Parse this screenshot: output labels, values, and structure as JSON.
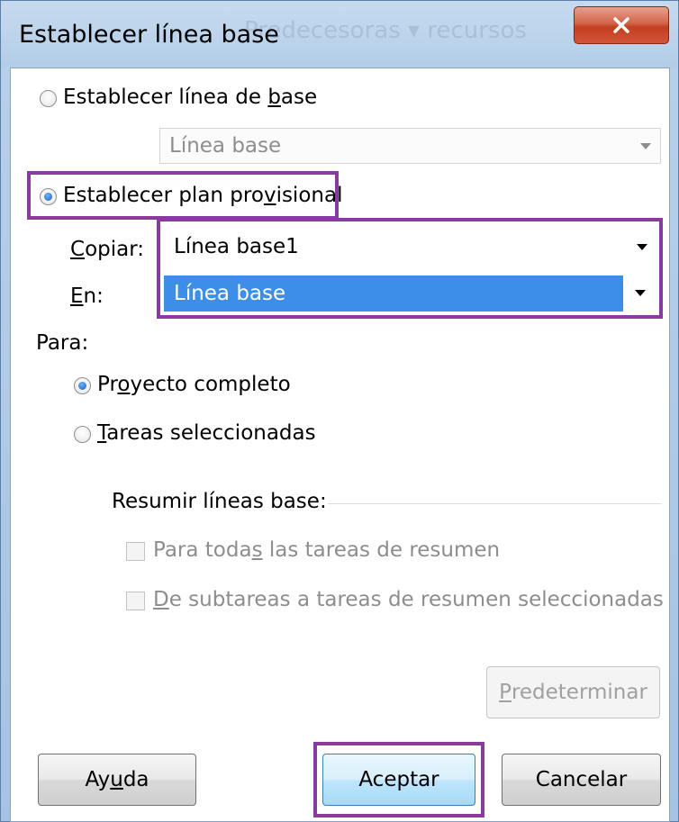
{
  "window": {
    "title": "Establecer línea base",
    "background_ghost_text": "Predecesoras ▾ recursos"
  },
  "options": {
    "set_baseline": {
      "pre": "Establecer línea de ",
      "u": "b",
      "post": "ase"
    },
    "baseline_select": "Línea base",
    "set_interim": {
      "pre": "Establecer plan pro",
      "u": "v",
      "post": "isional"
    },
    "copy_label": {
      "pre": "",
      "u": "C",
      "post": "opiar:"
    },
    "copy_value": "Línea base1",
    "into_label": {
      "pre": "",
      "u": "E",
      "post": "n:"
    },
    "into_value": "Línea base"
  },
  "scope": {
    "label": "Para:",
    "entire_project": {
      "pre": "Pr",
      "u": "o",
      "post": "yecto completo"
    },
    "selected_tasks": {
      "pre": "",
      "u": "T",
      "post": "areas seleccionadas"
    }
  },
  "rollup": {
    "label": "Resumir líneas base:",
    "all_summary": {
      "pre": "Para toda",
      "u": "s",
      "post": " las tareas de resumen"
    },
    "from_subtasks": {
      "pre": "",
      "u": "D",
      "post": "e subtareas a tareas de resumen seleccionadas"
    }
  },
  "buttons": {
    "default_set": {
      "pre": "",
      "u": "P",
      "post": "redeterminar"
    },
    "help": {
      "pre": "Ay",
      "u": "u",
      "post": "da"
    },
    "ok": "Aceptar",
    "cancel": "Cancelar"
  },
  "colors": {
    "highlight_border": "#8a3a9e",
    "selection": "#3d8ee6",
    "close_button": "#c9492c"
  }
}
